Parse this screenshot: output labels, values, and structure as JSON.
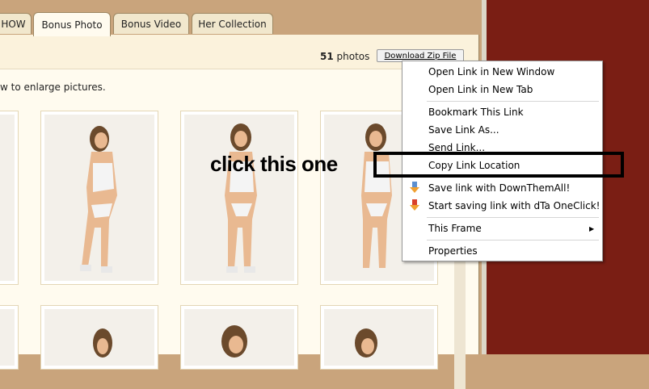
{
  "tabs": [
    {
      "label": "HOW",
      "active": false
    },
    {
      "label": "Bonus Photo",
      "active": true
    },
    {
      "label": "Bonus Video",
      "active": false
    },
    {
      "label": "Her Collection",
      "active": false
    }
  ],
  "gallery": {
    "photo_count": "51",
    "photo_count_unit": "photos",
    "download_button": "Download Zip File",
    "instructions": "w to enlarge pictures."
  },
  "context_menu": {
    "items": [
      {
        "label": "Open Link in New Window",
        "group": 1
      },
      {
        "label": "Open Link in New Tab",
        "group": 1
      },
      {
        "label": "Bookmark This Link",
        "group": 2
      },
      {
        "label": "Save Link As...",
        "group": 2
      },
      {
        "label": "Send Link...",
        "group": 2
      },
      {
        "label": "Copy Link Location",
        "group": 2
      },
      {
        "label": "Save link with DownThemAll!",
        "group": 3,
        "icon": "downthemall-icon"
      },
      {
        "label": "Start saving link with dTa OneClick!",
        "group": 3,
        "icon": "dta-oneclick-icon"
      },
      {
        "label": "This Frame",
        "group": 4,
        "submenu": true
      },
      {
        "label": "Properties",
        "group": 5
      }
    ]
  },
  "annotation": {
    "text": "click this one"
  },
  "colors": {
    "page_bg": "#c9a47c",
    "side_panel": "#7a1e14",
    "content_bg": "#fffbef",
    "annotation": "#000000"
  }
}
